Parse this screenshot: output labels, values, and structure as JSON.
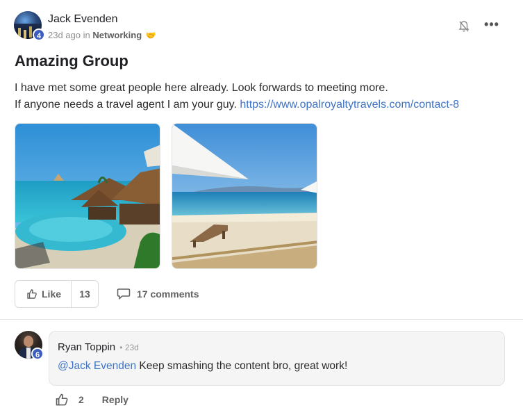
{
  "post": {
    "author": "Jack Evenden",
    "author_level": "4",
    "time": "23d ago",
    "in_label": "in",
    "category": "Networking",
    "category_emoji": "🤝",
    "title": "Amazing Group",
    "body_line1": "I have met some great people here already. Look forwards to meeting more.",
    "body_line2_prefix": "If anyone needs a travel agent I am your guy.",
    "link": "https://www.opalroyaltytravels.com/contact-8",
    "menu_glyph": "•••",
    "images": [
      {
        "alt": "resort-pool-photo"
      },
      {
        "alt": "beach-umbrella-photo"
      }
    ],
    "like_label": "Like",
    "like_count": "13",
    "comments_label": "17 comments"
  },
  "comment": {
    "author": "Ryan Toppin",
    "author_level": "6",
    "time": "• 23d",
    "mention": "@Jack Evenden",
    "text": "Keep smashing the content bro, great work!",
    "like_count": "2",
    "reply_label": "Reply"
  },
  "colors": {
    "link": "#3e73c4",
    "level_badge": "#3d5dbf",
    "category_emoji": "#f0a62a"
  }
}
